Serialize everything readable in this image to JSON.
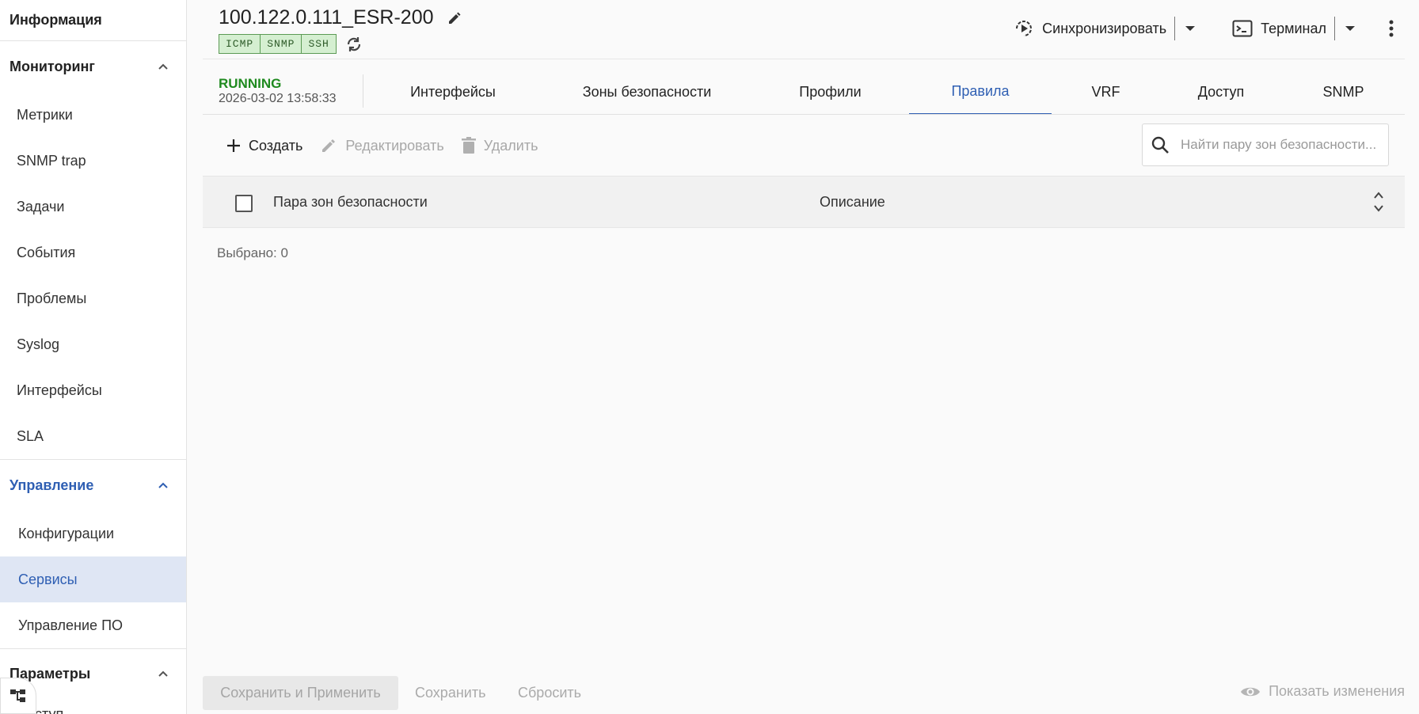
{
  "sidebar": {
    "info": "Информация",
    "monitoring": {
      "label": "Мониторинг",
      "items": [
        "Метрики",
        "SNMP trap",
        "Задачи",
        "События",
        "Проблемы",
        "Syslog",
        "Интерфейсы",
        "SLA"
      ]
    },
    "management": {
      "label": "Управление",
      "items": [
        "Конфигурации",
        "Сервисы",
        "Управление ПО"
      ]
    },
    "params": {
      "label": "Параметры",
      "items": [
        "ступ"
      ]
    }
  },
  "header": {
    "device_name": "100.122.0.111_ESR-200",
    "protocols": [
      "ICMP",
      "SNMP",
      "SSH"
    ],
    "sync_label": "Синхронизировать",
    "terminal_label": "Терминал"
  },
  "status": {
    "state": "RUNNING",
    "timestamp": "2026-03-02 13:58:33"
  },
  "tabs": [
    "Интерфейсы",
    "Зоны безопасности",
    "Профили",
    "Правила",
    "VRF",
    "Доступ",
    "SNMP"
  ],
  "active_tab": "Правила",
  "toolbar": {
    "create": "Создать",
    "edit": "Редактировать",
    "delete": "Удалить",
    "search_placeholder": "Найти пару зон безопасности..."
  },
  "table": {
    "columns": [
      "Пара зон безопасности",
      "Описание"
    ],
    "rows": []
  },
  "selected": "Выбрано: 0",
  "footer": {
    "save_apply": "Сохранить и Применить",
    "save": "Сохранить",
    "reset": "Сбросить",
    "show_changes": "Показать изменения"
  },
  "colors": {
    "accent": "#2f5fb3",
    "running": "#1f8a1f",
    "selected_bg": "#dfe6f4",
    "badge_bg": "#d5efd1"
  }
}
